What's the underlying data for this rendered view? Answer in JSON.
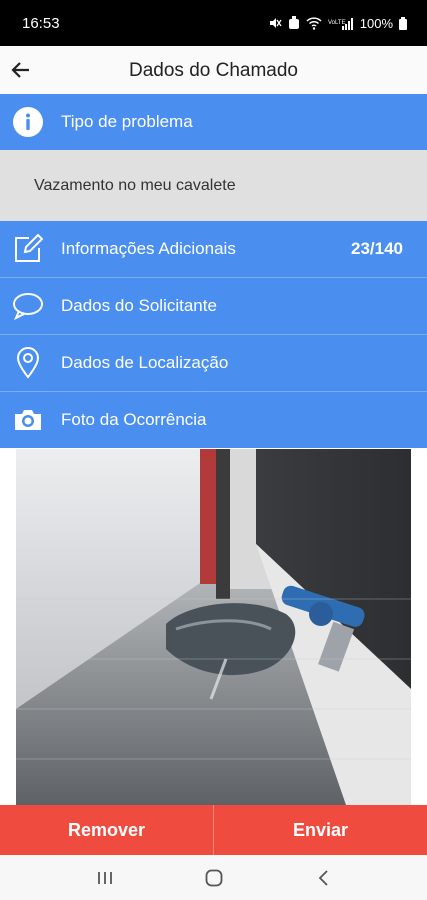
{
  "status": {
    "time": "16:53",
    "battery": "100%"
  },
  "header": {
    "title": "Dados do Chamado",
    "back_icon": "arrow-left-icon"
  },
  "sections": {
    "problem_type": {
      "label": "Tipo de problema",
      "icon": "info-icon",
      "value": "Vazamento no meu cavalete"
    },
    "additional_info": {
      "label": "Informações Adicionais",
      "icon": "edit-icon",
      "count": "23/140"
    },
    "requester": {
      "label": "Dados do Solicitante",
      "icon": "chat-bubble-icon"
    },
    "location": {
      "label": "Dados de Localização",
      "icon": "location-pin-icon"
    },
    "photo": {
      "label": "Foto da Ocorrência",
      "icon": "camera-icon"
    }
  },
  "actions": {
    "remove_label": "Remover",
    "send_label": "Enviar"
  },
  "colors": {
    "primary": "#4a8ff0",
    "danger": "#ef4b3e",
    "value_bg": "#e0e0e0"
  }
}
